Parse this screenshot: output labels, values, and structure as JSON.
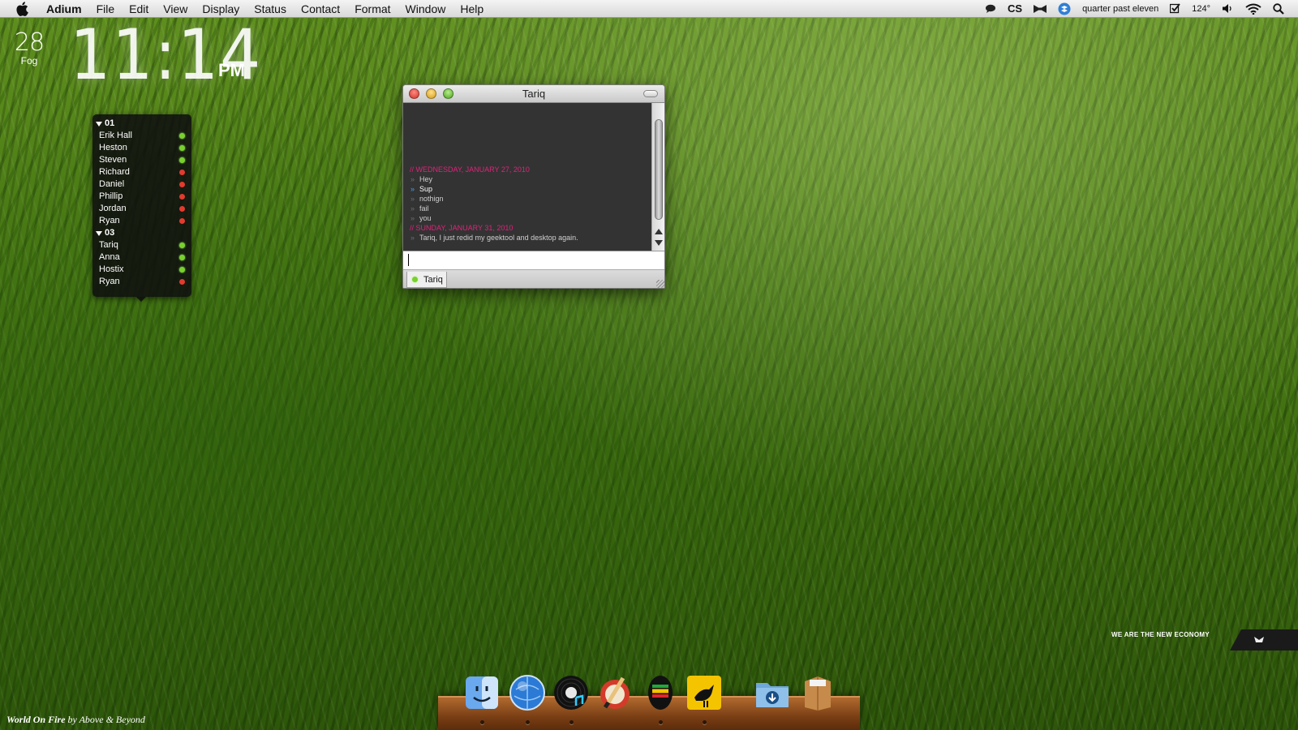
{
  "menubar": {
    "app": "Adium",
    "items": [
      "File",
      "Edit",
      "View",
      "Display",
      "Status",
      "Contact",
      "Format",
      "Window",
      "Help"
    ],
    "status_text": "quarter past eleven",
    "temperature": "124°",
    "icons": [
      "chat-bubble-icon",
      "cs-icon",
      "bowtie-icon",
      "dropbox-icon",
      "checkbox-icon",
      "volume-icon",
      "wifi-icon",
      "spotlight-icon"
    ],
    "cs_label": "CS"
  },
  "clock": {
    "temp": "28",
    "condition": "Fog",
    "time": "11:14",
    "ampm": "PM"
  },
  "contacts": {
    "groups": [
      {
        "name": "01",
        "items": [
          {
            "name": "Erik Hall",
            "status": "online"
          },
          {
            "name": "Heston",
            "status": "online"
          },
          {
            "name": "Steven",
            "status": "online"
          },
          {
            "name": "Richard",
            "status": "busy"
          },
          {
            "name": "Daniel",
            "status": "busy"
          },
          {
            "name": "Phillip",
            "status": "busy"
          },
          {
            "name": "Jordan",
            "status": "busy"
          },
          {
            "name": "Ryan",
            "status": "busy"
          }
        ]
      },
      {
        "name": "03",
        "items": [
          {
            "name": "Tariq",
            "status": "online"
          },
          {
            "name": "Anna",
            "status": "online"
          },
          {
            "name": "Hostix",
            "status": "online"
          },
          {
            "name": "Ryan",
            "status": "busy"
          }
        ]
      }
    ]
  },
  "chat": {
    "title": "Tariq",
    "tab_label": "Tariq",
    "transcript": [
      {
        "kind": "date",
        "text": "// WEDNESDAY, JANUARY 27, 2010"
      },
      {
        "kind": "them",
        "text": "Hey"
      },
      {
        "kind": "me",
        "text": "Sup"
      },
      {
        "kind": "them",
        "text": "nothign"
      },
      {
        "kind": "them",
        "text": "fail"
      },
      {
        "kind": "them",
        "text": "you"
      },
      {
        "kind": "date",
        "text": "// SUNDAY, JANUARY 31, 2010"
      },
      {
        "kind": "them",
        "text": "Tariq, I just redid my geektool and desktop again."
      }
    ],
    "marker": "»",
    "input_value": ""
  },
  "dock": {
    "apps": [
      "finder",
      "safari",
      "itunes",
      "pixelmator",
      "spotify",
      "twitter"
    ],
    "stacks": [
      "downloads",
      "documents"
    ]
  },
  "now_playing": {
    "title": "World On Fire",
    "by": "by",
    "artist": "Above & Beyond"
  },
  "wallpaper_tag": {
    "text": "WE ARE THE NEW ECONOMY"
  },
  "colors": {
    "online": "#79d12c",
    "busy": "#e23b2e",
    "date_header": "#e0227a",
    "self_marker": "#3aa0ff"
  }
}
